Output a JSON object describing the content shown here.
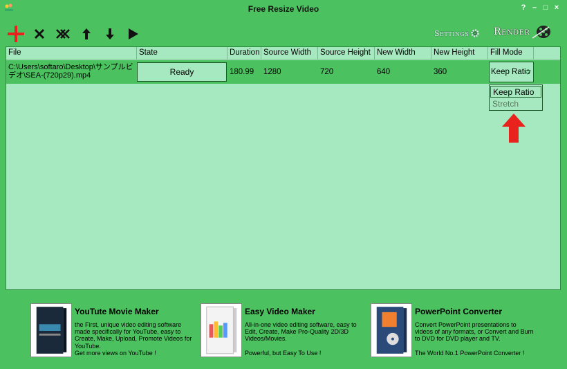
{
  "window": {
    "title": "Free Resize Video",
    "controls": [
      "?",
      "–",
      "□",
      "×"
    ]
  },
  "toolbar": {
    "items": [
      {
        "name": "add-icon"
      },
      {
        "name": "remove-icon"
      },
      {
        "name": "remove-all-icon"
      },
      {
        "name": "move-up-icon"
      },
      {
        "name": "move-down-icon"
      },
      {
        "name": "play-icon"
      }
    ],
    "settings_label": "Settings",
    "render_label": "Render"
  },
  "grid": {
    "columns": [
      "File",
      "State",
      "Duration",
      "Source Width",
      "Source Height",
      "New Width",
      "New Height",
      "Fill Mode"
    ],
    "rows": [
      {
        "file": "C:\\Users\\softaro\\Desktop\\サンプルビデオ\\SEA-(720p29).mp4",
        "state": "Ready",
        "duration": "180.99",
        "source_width": "1280",
        "source_height": "720",
        "new_width": "640",
        "new_height": "360",
        "fill_mode": "Keep Ratio"
      }
    ],
    "fill_mode_options": [
      "Keep Ratio",
      "Stretch"
    ]
  },
  "ads": [
    {
      "title": "YouTute Movie Maker",
      "desc": "the First, unique video editing software made specifically for YouTube, easy to Create, Make, Upload, Promote Videos for YouTube.\nGet more views on YouTube !"
    },
    {
      "title": "Easy Video Maker",
      "desc": "All-in-one video editing software, easy to Edit, Create, Make Pro-Quality 2D/3D Videos/Movies.\n\nPowerful, but Easy To Use !"
    },
    {
      "title": "PowerPoint Converter",
      "desc": "Convert PowerPoint presentations to videos of any formats, or Convert and Burn to DVD for DVD player and TV.\n\nThe World No.1 PowerPoint Converter !"
    }
  ],
  "colors": {
    "background": "#4cc15f",
    "grid": "#a6e8bf",
    "accent_red": "#e8231e"
  }
}
